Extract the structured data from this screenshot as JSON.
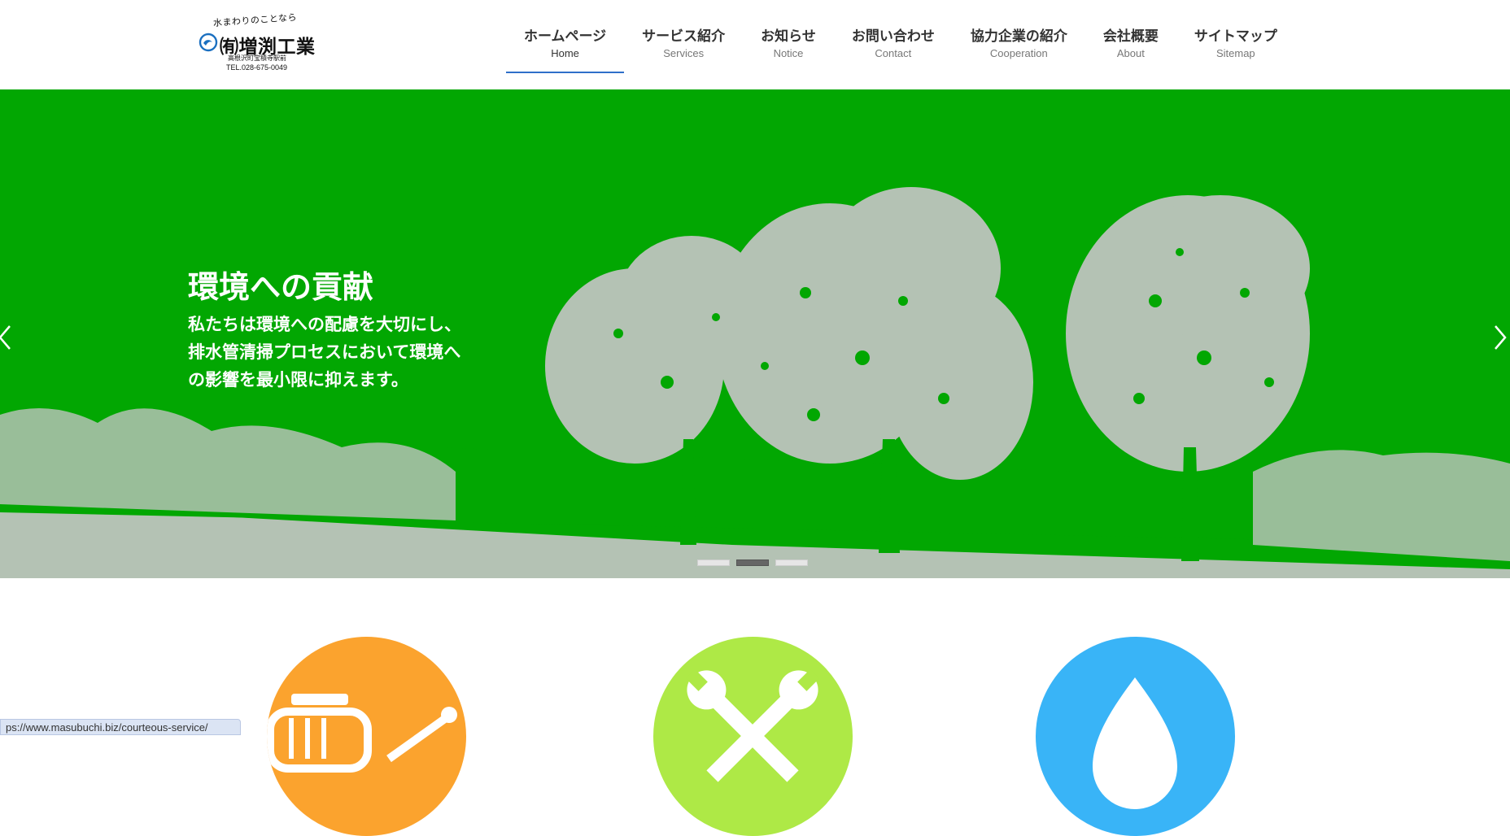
{
  "logo": {
    "tagline": "水まわりのことなら",
    "name": "㈲増渕工業",
    "address": "高根沢町宝積寺駅前",
    "tel": "TEL.028-675-0049"
  },
  "nav": {
    "items": [
      {
        "ja": "ホームページ",
        "en": "Home"
      },
      {
        "ja": "サービス紹介",
        "en": "Services"
      },
      {
        "ja": "お知らせ",
        "en": "Notice"
      },
      {
        "ja": "お問い合わせ",
        "en": "Contact"
      },
      {
        "ja": "協力企業の紹介",
        "en": "Cooperation"
      },
      {
        "ja": "会社概要",
        "en": "About"
      },
      {
        "ja": "サイトマップ",
        "en": "Sitemap"
      }
    ],
    "active_index": 0
  },
  "hero": {
    "title": "環境への貢献",
    "lines": [
      "私たちは環境への配慮を大切にし、",
      "排水管清掃プロセスにおいて環境へ",
      "の影響を最小限に抑えます。"
    ],
    "slide_count": 3,
    "active_slide": 1
  },
  "services": {
    "items": [
      {
        "icon": "truck-wrench-icon",
        "color": "#fba32e"
      },
      {
        "icon": "wrench-cross-icon",
        "color": "#aee946"
      },
      {
        "icon": "water-drop-icon",
        "color": "#39b4f7"
      }
    ]
  },
  "status_bar": {
    "url": "ps://www.masubuchi.biz/courteous-service/"
  },
  "colors": {
    "hero_bg": "#02a702",
    "hero_trees": "#b4c2b4",
    "nav_active": "#2f6fc9"
  }
}
